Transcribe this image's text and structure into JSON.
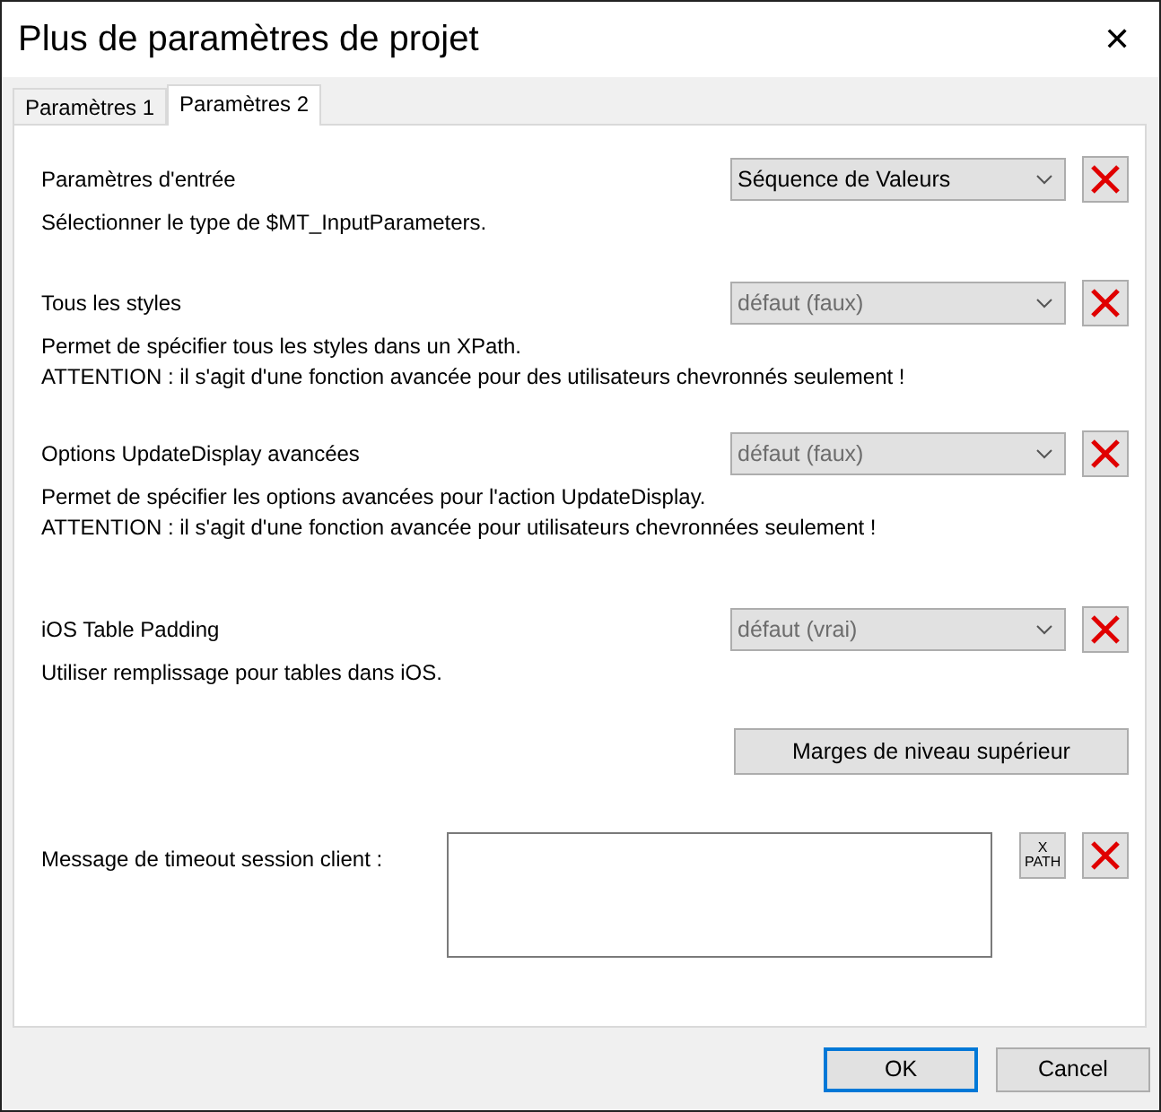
{
  "window": {
    "title": "Plus de paramètres de projet",
    "close": "✕"
  },
  "tabs": [
    {
      "label": "Paramètres 1",
      "selected": false
    },
    {
      "label": "Paramètres 2",
      "selected": true
    }
  ],
  "settings": [
    {
      "label": "Paramètres d'entrée",
      "value": "Séquence de Valeurs",
      "default": false,
      "description": [
        "Sélectionner le type de $MT_InputParameters."
      ]
    },
    {
      "label": "Tous les styles",
      "value": "défaut (faux)",
      "default": true,
      "description": [
        "Permet de spécifier tous les styles dans un XPath.",
        "ATTENTION : il s'agit d'une fonction avancée pour des utilisateurs chevronnés seulement !"
      ]
    },
    {
      "label": "Options UpdateDisplay avancées",
      "value": "défaut (faux)",
      "default": true,
      "description": [
        "Permet de spécifier les options avancées pour l'action UpdateDisplay.",
        "ATTENTION : il s'agit d'une fonction avancée pour utilisateurs chevronnées seulement !"
      ]
    },
    {
      "label": "iOS Table Padding",
      "value": "défaut (vrai)",
      "default": true,
      "description": [
        "Utiliser remplissage pour tables dans iOS."
      ]
    }
  ],
  "margins_button": "Marges de niveau supérieur",
  "timeout": {
    "label": "Message de timeout session client :",
    "xpath_button": [
      "X",
      "PATH"
    ]
  },
  "buttons": [
    {
      "label": "OK",
      "focused": true
    },
    {
      "label": "Cancel",
      "focused": false
    }
  ]
}
